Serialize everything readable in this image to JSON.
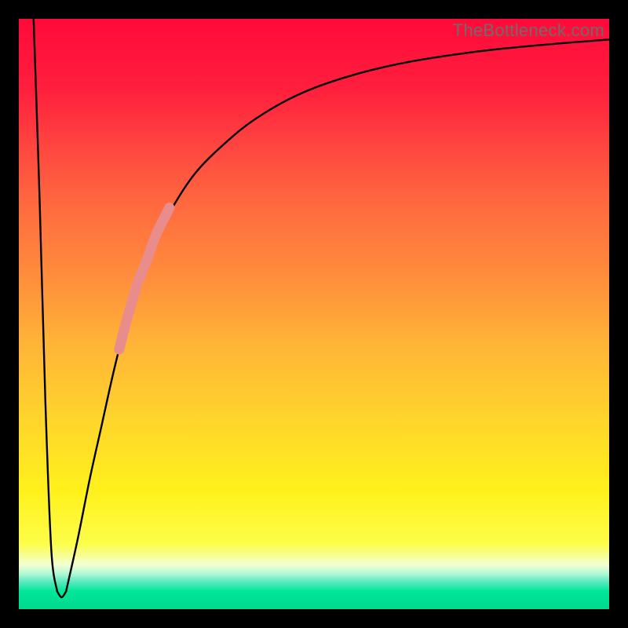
{
  "watermark": "TheBottleneck.com",
  "colors": {
    "curve_stroke": "#000000",
    "highlight_stroke": "#e98c8c",
    "frame_bg": "#000000"
  },
  "chart_data": {
    "type": "line",
    "title": "",
    "xlabel": "",
    "ylabel": "",
    "xlim": [
      0,
      100
    ],
    "ylim": [
      0,
      100
    ],
    "grid": false,
    "legend": false,
    "series": [
      {
        "name": "bottleneck-curve-left",
        "x": [
          2.5,
          3.5,
          4.5,
          5.5,
          6.5
        ],
        "values": [
          100,
          70,
          35,
          10,
          3
        ]
      },
      {
        "name": "bottleneck-curve-right",
        "x": [
          8.0,
          10,
          12,
          14,
          16,
          18,
          20,
          23,
          26,
          30,
          35,
          40,
          47,
          55,
          65,
          78,
          90,
          100
        ],
        "values": [
          3,
          12,
          22,
          31,
          40,
          48,
          55,
          62,
          68,
          74,
          79,
          83,
          87,
          90,
          92.5,
          94.5,
          95.7,
          96.5
        ]
      }
    ],
    "highlight_segment": {
      "name": "highlight-on-curve",
      "x": [
        17.0,
        18.0,
        19.0,
        20.0,
        21.0,
        22.0,
        22.7,
        23.5,
        24.5,
        25.5
      ],
      "values": [
        44,
        48,
        51.5,
        55,
        57.5,
        60,
        62,
        64,
        66,
        68
      ]
    },
    "highlight_dots": {
      "name": "highlight-dots-below",
      "x": [
        20.7,
        21.4
      ],
      "values": [
        56.5,
        58.5
      ]
    }
  }
}
